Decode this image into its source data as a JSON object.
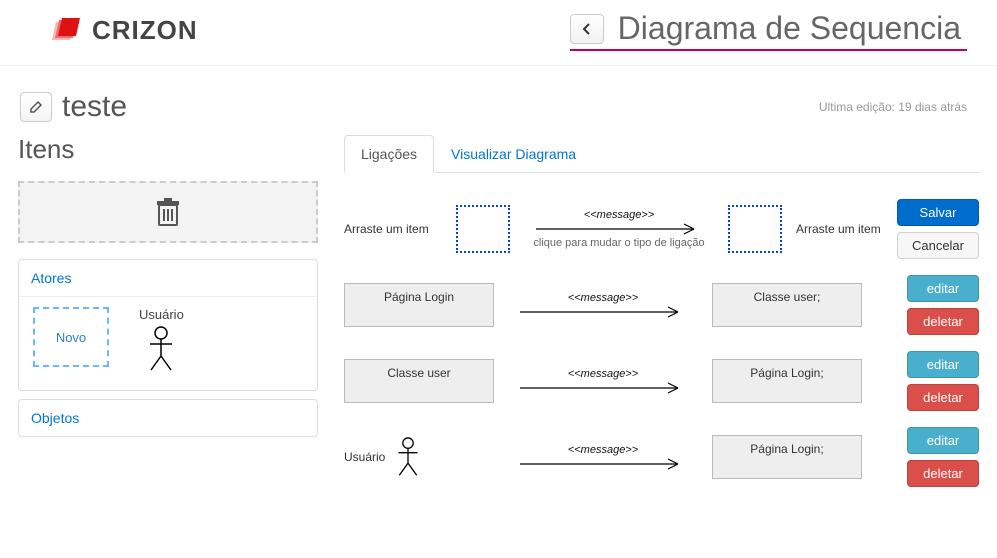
{
  "brand": "CRIZON",
  "page_title": "Diagrama de Sequencia",
  "project_name": "teste",
  "last_edit": "Ultima edição: 19 dias atrás",
  "left": {
    "title": "Itens",
    "panel_atores": "Atores",
    "panel_objetos": "Objetos",
    "new_label": "Novo",
    "actor_label": "Usuário"
  },
  "tabs": {
    "ligacoes": "Ligações",
    "visualizar": "Visualizar Diagrama"
  },
  "editor": {
    "drag_hint": "Arraste um item",
    "message_label": "<<message>>",
    "type_hint": "clique para mudar o tipo de ligação",
    "save": "Salvar",
    "cancel": "Cancelar",
    "edit": "editar",
    "delete": "deletar",
    "rows": [
      {
        "from": "Página Login",
        "to": "Classe user;"
      },
      {
        "from": "Classe user",
        "to": "Página Login;"
      },
      {
        "from_actor": "Usuário",
        "to": "Página Login;"
      }
    ]
  }
}
